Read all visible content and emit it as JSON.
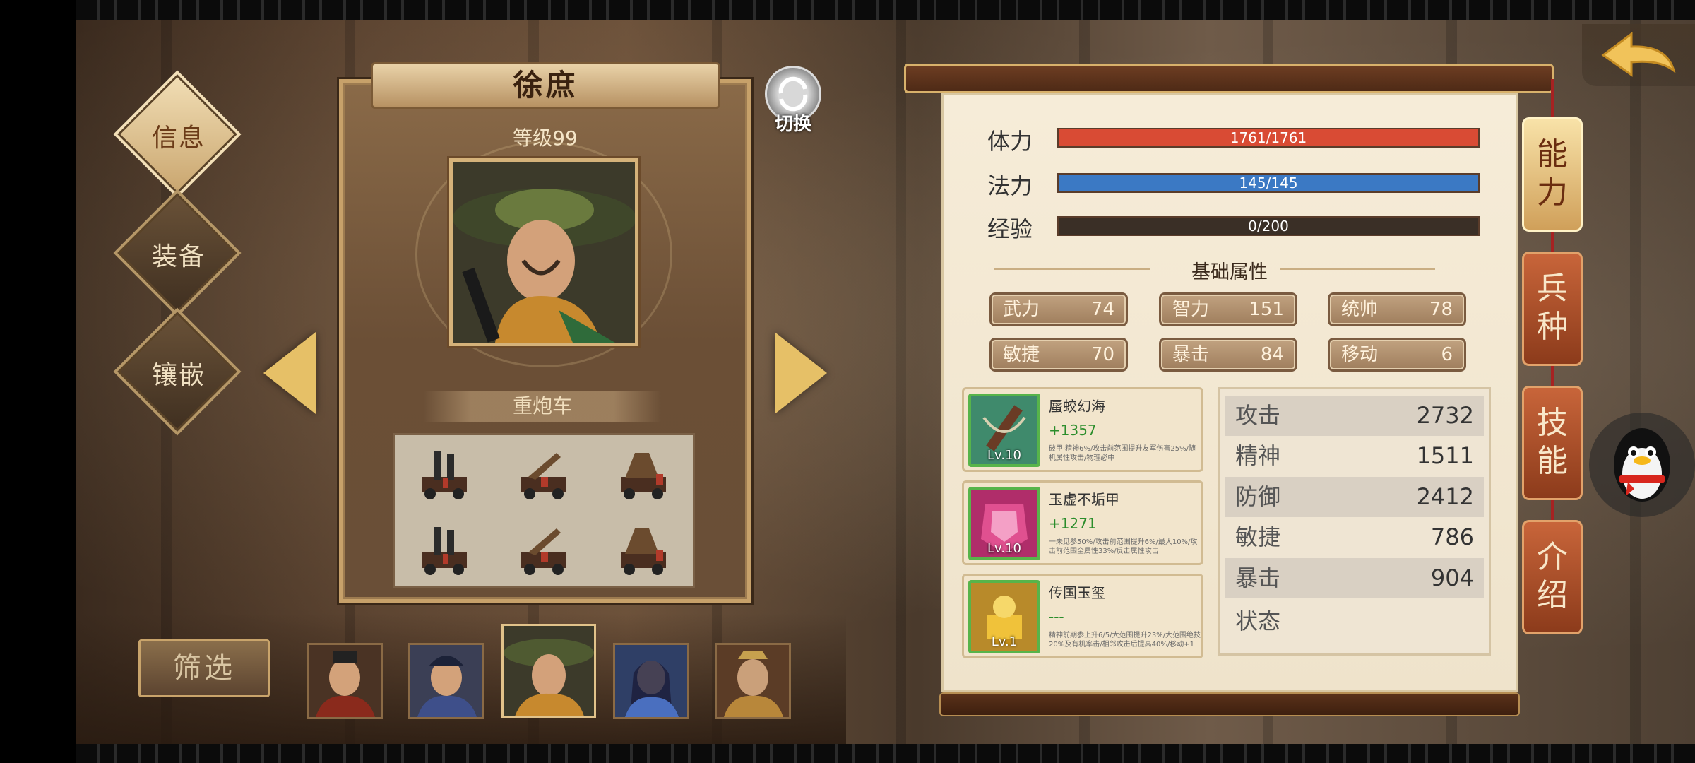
{
  "nav": {
    "items": [
      {
        "label": "信息",
        "active": true
      },
      {
        "label": "装备",
        "active": false
      },
      {
        "label": "镶嵌",
        "active": false
      }
    ]
  },
  "hero": {
    "name": "徐庶",
    "level": "等级99",
    "unit_type": "重炮车",
    "switch_label": "切换"
  },
  "filter": {
    "label": "筛选"
  },
  "bars": {
    "hp": {
      "label": "体力",
      "value": "1761/1761",
      "fill": 1.0,
      "color": "#d94b34"
    },
    "mp": {
      "label": "法力",
      "value": "145/145",
      "fill": 1.0,
      "color": "#3b79c4"
    },
    "exp": {
      "label": "经验",
      "value": "0/200",
      "fill": 0.0,
      "color": "#3a2f26"
    }
  },
  "base_attrs": {
    "title": "基础属性",
    "items": [
      {
        "name": "武力",
        "value": "74"
      },
      {
        "name": "智力",
        "value": "151"
      },
      {
        "name": "统帅",
        "value": "78"
      },
      {
        "name": "敏捷",
        "value": "70"
      },
      {
        "name": "暴击",
        "value": "84"
      },
      {
        "name": "移动",
        "value": "6"
      }
    ]
  },
  "equipment": [
    {
      "name": "蜃蛟幻海",
      "bonus": "+1357",
      "level": "Lv.10",
      "desc": "破甲·精神6%/攻击前范围提升友军伤害25%/随机属性攻击/物理必中",
      "bg": "#3f8a6c"
    },
    {
      "name": "玉虚不垢甲",
      "bonus": "+1271",
      "level": "Lv.10",
      "desc": "一未见参50%/攻击前范围提升6%/最大10%/攻击前范围全属性33%/反击属性攻击",
      "bg": "#b02d6a"
    },
    {
      "name": "传国玉玺",
      "bonus": "---",
      "level": "Lv.1",
      "desc": "精神前期参上升6/5/大范围提升23%/大范围绝技20%及有机率击/相邻攻击后提高40%/移动+1",
      "bg": "#b88a2a"
    }
  ],
  "stats": [
    {
      "name": "攻击",
      "value": "2732"
    },
    {
      "name": "精神",
      "value": "1511"
    },
    {
      "name": "防御",
      "value": "2412"
    },
    {
      "name": "敏捷",
      "value": "786"
    },
    {
      "name": "暴击",
      "value": "904"
    },
    {
      "name": "状态",
      "value": ""
    }
  ],
  "side_tabs": [
    {
      "label": "能力",
      "active": true
    },
    {
      "label": "兵种",
      "active": false
    },
    {
      "label": "技能",
      "active": false
    },
    {
      "label": "介绍",
      "active": false
    }
  ]
}
